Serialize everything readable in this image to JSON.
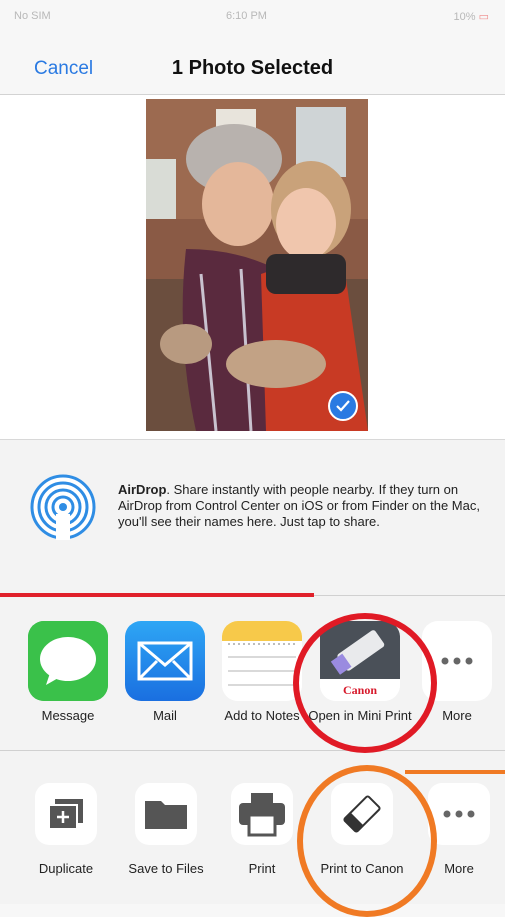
{
  "status_bar": {
    "carrier": "No SIM",
    "time": "6:10 PM",
    "battery": "10%"
  },
  "nav": {
    "cancel_label": "Cancel",
    "title": "1 Photo Selected"
  },
  "airdrop": {
    "title": "AirDrop",
    "description": ". Share instantly with people nearby. If they turn on AirDrop from Control Center on iOS or from Finder on the Mac, you'll see their names here. Just tap to share."
  },
  "share_row": [
    {
      "label": "Message",
      "icon": "message-app-icon"
    },
    {
      "label": "Mail",
      "icon": "mail-app-icon"
    },
    {
      "label": "Add to Notes",
      "icon": "notes-app-icon"
    },
    {
      "label": "Open in Mini Print",
      "icon": "canon-mini-print-app-icon",
      "brand": "Canon"
    },
    {
      "label": "More",
      "icon": "more-dots-icon"
    }
  ],
  "action_row": [
    {
      "label": "Duplicate",
      "icon": "duplicate-icon"
    },
    {
      "label": "Save to Files",
      "icon": "folder-icon"
    },
    {
      "label": "Print",
      "icon": "printer-icon"
    },
    {
      "label": "Print to Canon",
      "icon": "canon-print-icon"
    },
    {
      "label": "More",
      "icon": "more-dots-icon"
    }
  ],
  "colors": {
    "accent": "#2a7ae2",
    "highlight_red": "#e01a25",
    "highlight_orange": "#f07a24"
  }
}
